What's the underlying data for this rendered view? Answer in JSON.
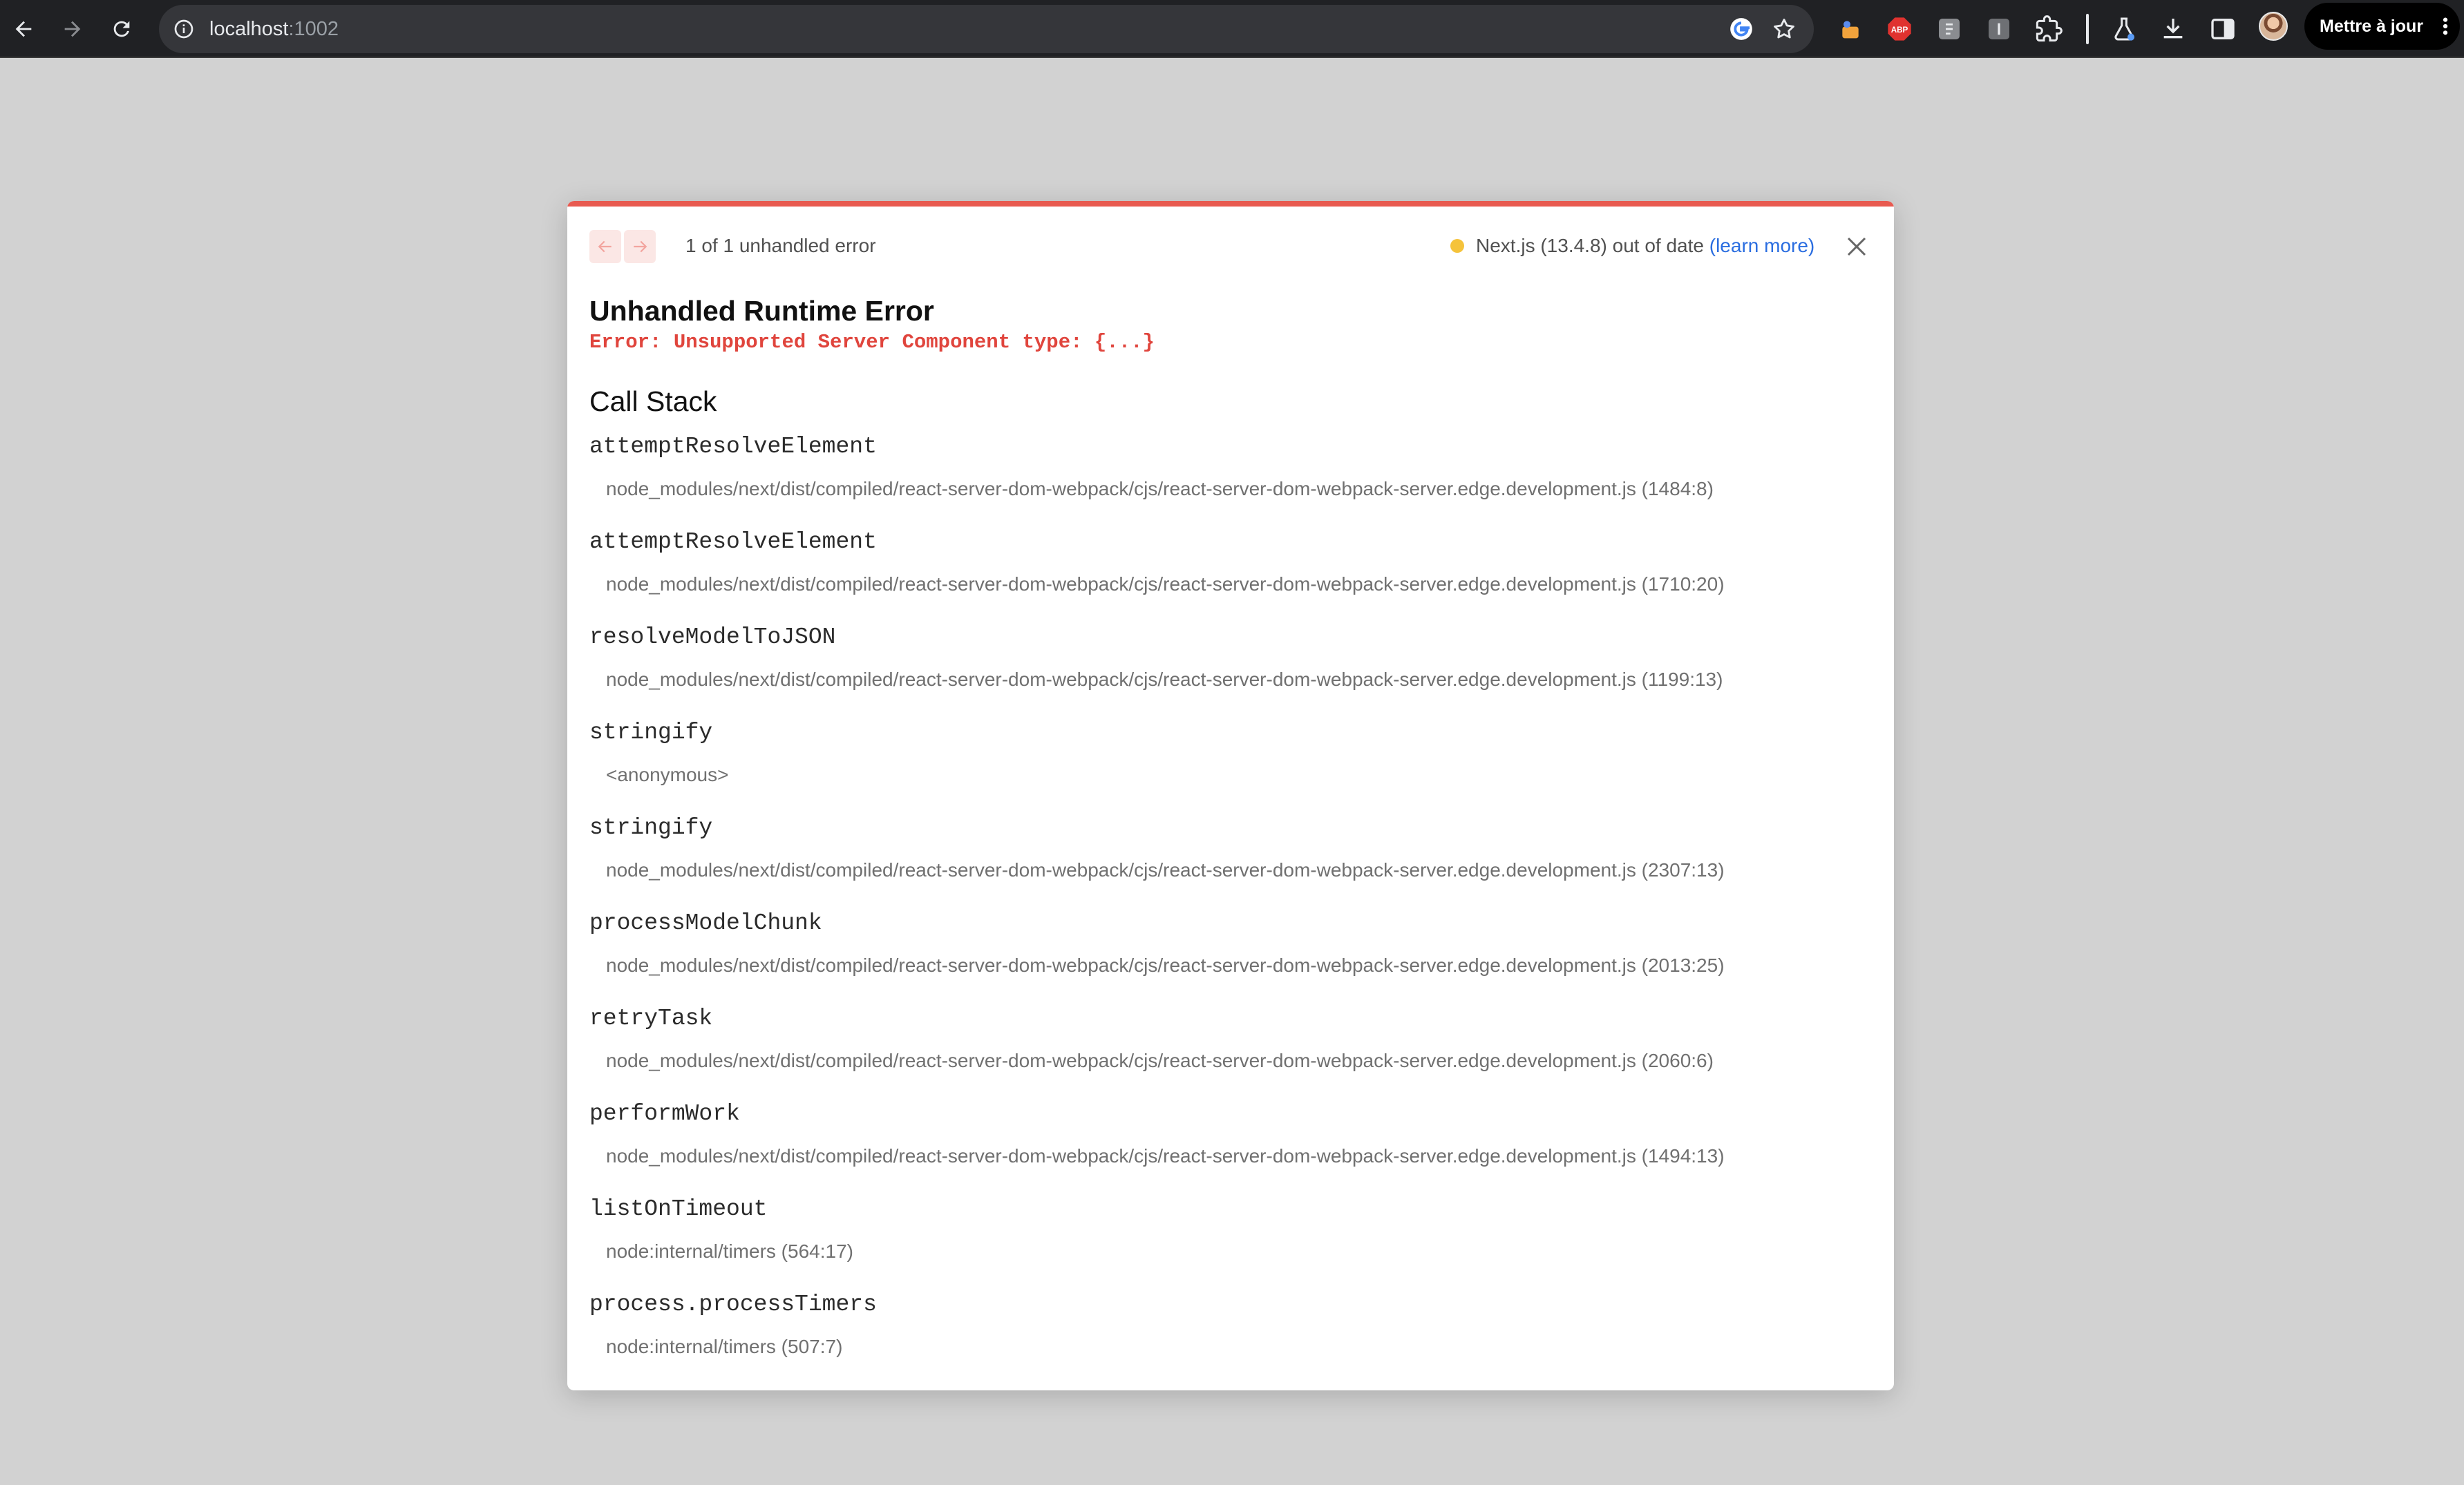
{
  "browser": {
    "url_host": "localhost",
    "url_port": ":1002",
    "update_button_label": "Mettre à jour",
    "extensions": [
      "extension-icon-1",
      "adblock-plus-icon",
      "extension-icon-3",
      "extension-icon-4",
      "puzzle-extensions-icon",
      "labs-flask-icon",
      "download-icon",
      "side-panel-icon"
    ]
  },
  "dialog": {
    "accent_color": "#e85a50",
    "error_count_text": "1 of 1 unhandled error",
    "version_text": "Next.js (13.4.8) out of date",
    "learn_more_label": "(learn more)",
    "title": "Unhandled Runtime Error",
    "error_message": "Error: Unsupported Server Component type: {...}",
    "call_stack_heading": "Call Stack",
    "frames": [
      {
        "fn": "attemptResolveElement",
        "loc": "node_modules/next/dist/compiled/react-server-dom-webpack/cjs/react-server-dom-webpack-server.edge.development.js (1484:8)"
      },
      {
        "fn": "attemptResolveElement",
        "loc": "node_modules/next/dist/compiled/react-server-dom-webpack/cjs/react-server-dom-webpack-server.edge.development.js (1710:20)"
      },
      {
        "fn": "resolveModelToJSON",
        "loc": "node_modules/next/dist/compiled/react-server-dom-webpack/cjs/react-server-dom-webpack-server.edge.development.js (1199:13)"
      },
      {
        "fn": "stringify",
        "loc": "<anonymous>"
      },
      {
        "fn": "stringify",
        "loc": "node_modules/next/dist/compiled/react-server-dom-webpack/cjs/react-server-dom-webpack-server.edge.development.js (2307:13)"
      },
      {
        "fn": "processModelChunk",
        "loc": "node_modules/next/dist/compiled/react-server-dom-webpack/cjs/react-server-dom-webpack-server.edge.development.js (2013:25)"
      },
      {
        "fn": "retryTask",
        "loc": "node_modules/next/dist/compiled/react-server-dom-webpack/cjs/react-server-dom-webpack-server.edge.development.js (2060:6)"
      },
      {
        "fn": "performWork",
        "loc": "node_modules/next/dist/compiled/react-server-dom-webpack/cjs/react-server-dom-webpack-server.edge.development.js (1494:13)"
      },
      {
        "fn": "listOnTimeout",
        "loc": "node:internal/timers (564:17)"
      },
      {
        "fn": "process.processTimers",
        "loc": "node:internal/timers (507:7)"
      }
    ]
  }
}
